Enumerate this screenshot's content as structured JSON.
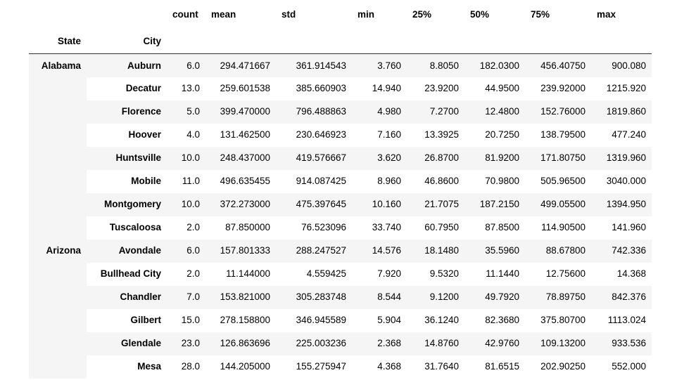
{
  "table": {
    "index_headers": [
      "State",
      "City"
    ],
    "stat_headers": [
      "count",
      "mean",
      "std",
      "min",
      "25%",
      "50%",
      "75%",
      "max"
    ],
    "rows": [
      {
        "state": "Alabama",
        "city": "Auburn",
        "count": "6.0",
        "mean": "294.471667",
        "std": "361.914543",
        "min": "3.760",
        "p25": "8.8050",
        "p50": "182.0300",
        "p75": "456.40750",
        "max": "900.080"
      },
      {
        "state": "",
        "city": "Decatur",
        "count": "13.0",
        "mean": "259.601538",
        "std": "385.660903",
        "min": "14.940",
        "p25": "23.9200",
        "p50": "44.9500",
        "p75": "239.92000",
        "max": "1215.920"
      },
      {
        "state": "",
        "city": "Florence",
        "count": "5.0",
        "mean": "399.470000",
        "std": "796.488863",
        "min": "4.980",
        "p25": "7.2700",
        "p50": "12.4800",
        "p75": "152.76000",
        "max": "1819.860"
      },
      {
        "state": "",
        "city": "Hoover",
        "count": "4.0",
        "mean": "131.462500",
        "std": "230.646923",
        "min": "7.160",
        "p25": "13.3925",
        "p50": "20.7250",
        "p75": "138.79500",
        "max": "477.240"
      },
      {
        "state": "",
        "city": "Huntsville",
        "count": "10.0",
        "mean": "248.437000",
        "std": "419.576667",
        "min": "3.620",
        "p25": "26.8700",
        "p50": "81.9200",
        "p75": "171.80750",
        "max": "1319.960"
      },
      {
        "state": "",
        "city": "Mobile",
        "count": "11.0",
        "mean": "496.635455",
        "std": "914.087425",
        "min": "8.960",
        "p25": "46.8600",
        "p50": "70.9800",
        "p75": "505.96500",
        "max": "3040.000"
      },
      {
        "state": "",
        "city": "Montgomery",
        "count": "10.0",
        "mean": "372.273000",
        "std": "475.397645",
        "min": "10.160",
        "p25": "21.7075",
        "p50": "187.2150",
        "p75": "499.05500",
        "max": "1394.950"
      },
      {
        "state": "",
        "city": "Tuscaloosa",
        "count": "2.0",
        "mean": "87.850000",
        "std": "76.523096",
        "min": "33.740",
        "p25": "60.7950",
        "p50": "87.8500",
        "p75": "114.90500",
        "max": "141.960"
      },
      {
        "state": "Arizona",
        "city": "Avondale",
        "count": "6.0",
        "mean": "157.801333",
        "std": "288.247527",
        "min": "14.576",
        "p25": "18.1480",
        "p50": "35.5960",
        "p75": "88.67800",
        "max": "742.336"
      },
      {
        "state": "",
        "city": "Bullhead City",
        "count": "2.0",
        "mean": "11.144000",
        "std": "4.559425",
        "min": "7.920",
        "p25": "9.5320",
        "p50": "11.1440",
        "p75": "12.75600",
        "max": "14.368"
      },
      {
        "state": "",
        "city": "Chandler",
        "count": "7.0",
        "mean": "153.821000",
        "std": "305.283748",
        "min": "8.544",
        "p25": "9.1200",
        "p50": "49.7920",
        "p75": "78.89750",
        "max": "842.376"
      },
      {
        "state": "",
        "city": "Gilbert",
        "count": "15.0",
        "mean": "278.158800",
        "std": "346.945589",
        "min": "5.904",
        "p25": "36.1240",
        "p50": "82.3680",
        "p75": "375.80700",
        "max": "1113.024"
      },
      {
        "state": "",
        "city": "Glendale",
        "count": "23.0",
        "mean": "126.863696",
        "std": "225.003236",
        "min": "2.368",
        "p25": "14.8760",
        "p50": "42.9760",
        "p75": "109.13200",
        "max": "933.536"
      },
      {
        "state": "",
        "city": "Mesa",
        "count": "28.0",
        "mean": "144.205000",
        "std": "155.275947",
        "min": "4.368",
        "p25": "31.7640",
        "p50": "81.6515",
        "p75": "202.90250",
        "max": "552.000"
      }
    ]
  }
}
